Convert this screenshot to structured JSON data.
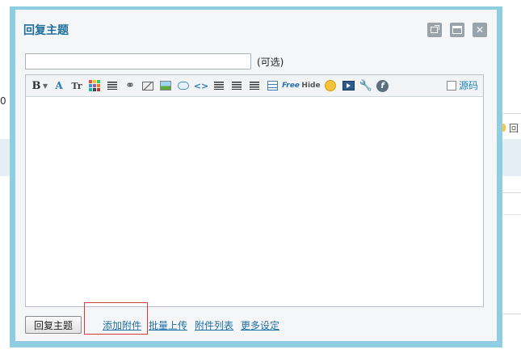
{
  "background": {
    "left_fragment": "0",
    "right_fragment": "回"
  },
  "dialog": {
    "title": "回复主题",
    "window_buttons": [
      {
        "name": "popout-icon"
      },
      {
        "name": "maximize-icon"
      },
      {
        "name": "close-icon",
        "glyph": "✕"
      }
    ],
    "subject": {
      "value": "",
      "placeholder": "",
      "optional_label": "(可选)"
    },
    "toolbar": {
      "bold": "B",
      "dropdown": "▼",
      "size": "Tr",
      "code": "<>",
      "free": "Free",
      "hide": "Hide",
      "flash": "f",
      "source_label": "源码",
      "source_checked": false
    },
    "actions": {
      "reply_button": "回复主题",
      "add_attachment": "添加附件",
      "batch_upload": "批量上传",
      "attachment_list": "附件列表",
      "more_settings": "更多设定"
    }
  },
  "colors": {
    "dialog_border": "#8fcde0",
    "title": "#1f6f9c",
    "link": "#1f6fa6",
    "highlight_box": "#d23c3c"
  }
}
